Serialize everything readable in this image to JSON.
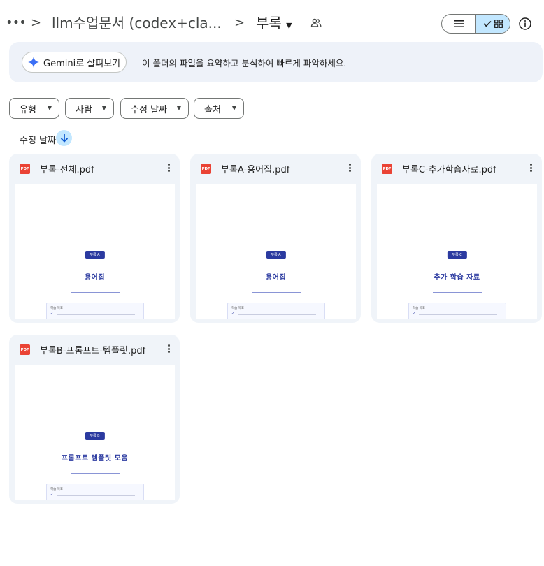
{
  "header": {
    "more_label": "•••",
    "breadcrumb_parent": "llm수업문서 (codex+cla...",
    "breadcrumb_current": "부록",
    "separator": ">",
    "caret": "▼"
  },
  "banner": {
    "button_label": "Gemini로 살펴보기",
    "text": "이 폴더의 파일을 요약하고 분석하여 빠르게 파악하세요."
  },
  "filters": [
    {
      "label": "유형"
    },
    {
      "label": "사람"
    },
    {
      "label": "수정 날짜"
    },
    {
      "label": "출처"
    }
  ],
  "filter_caret": "▼",
  "sort": {
    "label": "수정 날짜"
  },
  "files": [
    {
      "name": "부록-전체.pdf",
      "type_badge": "PDF",
      "thumb_badge": "부록 A",
      "thumb_heading": "용어집",
      "thumb_box_label": "학습 목표"
    },
    {
      "name": "부록A-용어집.pdf",
      "type_badge": "PDF",
      "thumb_badge": "부록 A",
      "thumb_heading": "용어집",
      "thumb_box_label": "학습 목표"
    },
    {
      "name": "부록C-추가학습자료.pdf",
      "type_badge": "PDF",
      "thumb_badge": "부록 C",
      "thumb_heading": "추가 학습 자료",
      "thumb_box_label": "학습 목표"
    },
    {
      "name": "부록B-프롬프트-템플릿.pdf",
      "type_badge": "PDF",
      "thumb_badge": "부록 B",
      "thumb_heading": "프롬프트 템플릿 모음",
      "thumb_box_label": "학습 목표"
    }
  ],
  "colors": {
    "accent": "#c2e7ff",
    "banner_bg": "#eef2f9",
    "card_bg": "#f0f4f9",
    "pdf_red": "#ea4335",
    "doc_blue": "#2b3aa0"
  },
  "icons": {
    "share": "people-icon",
    "list_view": "list-icon",
    "grid_view": "grid-icon",
    "info": "info-icon",
    "gemini": "sparkle-icon",
    "sort": "arrow-down-icon",
    "file_menu": "kebab-icon"
  }
}
